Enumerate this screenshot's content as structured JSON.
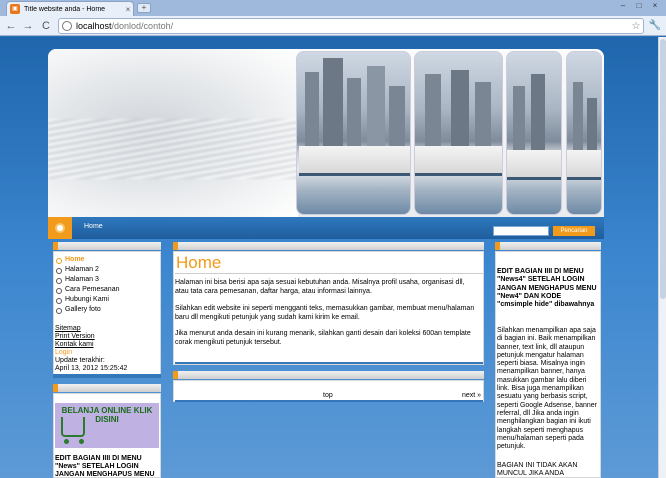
{
  "browser": {
    "tab_title": "Title website anda - Home",
    "tab_close": "×",
    "new_tab": "+",
    "url_host": "localhost",
    "url_path": "/donlod/contoh/",
    "back": "←",
    "forward": "→",
    "reload": "C",
    "star": "☆",
    "wrench": "🔧",
    "win_min": "–",
    "win_max": "□",
    "win_close": "×"
  },
  "nav": {
    "home": "Home"
  },
  "search": {
    "button": "Pencarian",
    "value": ""
  },
  "menu": {
    "items": [
      "Home",
      "Halaman 2",
      "Halaman 3",
      "Cara Pemesanan",
      "Hubungi Kami",
      "Gallery foto"
    ]
  },
  "links": {
    "sitemap": "Sitemap",
    "print_version": "Print Version",
    "kontak": "Kontak kami",
    "login": "Login",
    "update_label": "Update terakhir:",
    "update_date": "April 13, 2012 15:25:42"
  },
  "banner": {
    "title": "BELANJA ONLINE KLIK DISINI"
  },
  "left_notice": "EDIT BAGIAN IIII DI MENU \"News\" SETELAH LOGIN JANGAN MENGHAPUS MENU",
  "main": {
    "title": "Home",
    "p1": "Halaman ini bisa berisi apa saja sesuai kebutuhan anda. Misalnya profil usaha, organisasi dll, atau tata cara pemesanan, daftar harga, atau informasi lainnya.",
    "p2": "Silahkan edit website ini seperti mengganti teks, memasukkan gambar, membuat menu/halaman baru dll mengikuti petunjuk yang sudah kami kirim ke email.",
    "p3": "Jika menurut anda desain ini kurang menarik, silahkan ganti desain dari koleksi 600an template corak mengikuti petunjuk tersebut.",
    "top": "top",
    "next": "next »"
  },
  "right": {
    "notice": "EDIT BAGIAN IIII DI MENU \"News4\" SETELAH LOGIN JANGAN MENGHAPUS MENU \"New4\" DAN KODE \"cmsimple hide\" dibawahnya",
    "body": "Silahkan menampilkan apa saja di bagian ini. Baik menampilkan banner, text link, dll ataupun petunjuk mengatur halaman seperti biasa. Misalnya ingin menampilkan banner, hanya masukkan gambar lalu diberi link. Bisa juga menampilkan sesuatu yang berbasis script, seperti Google Adsense, banner referral, dll Jika anda ingin menghilangkan bagian ini ikuti langkah seperti menghapus menu/halaman seperti pada petunjuk.",
    "footer": "BAGIAN INI TIDAK AKAN MUNCUL JIKA ANDA"
  },
  "colors": {
    "accent": "#f19a1b",
    "brand_blue": "#2f78be"
  }
}
